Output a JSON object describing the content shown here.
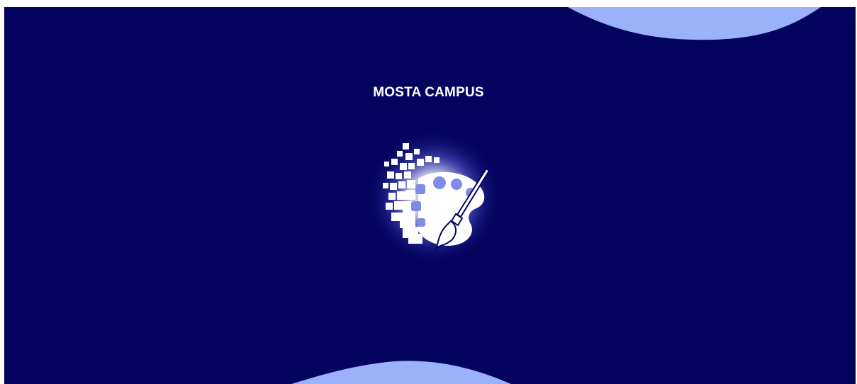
{
  "page": {
    "campus_name": "MOSTA CAMPUS",
    "logo_icon": "pixel-palette-brush-icon"
  },
  "colors": {
    "background": "#02045f",
    "wave": "#9bb2fb",
    "logo_glow": "#ffffff",
    "text": "#ffffff"
  }
}
